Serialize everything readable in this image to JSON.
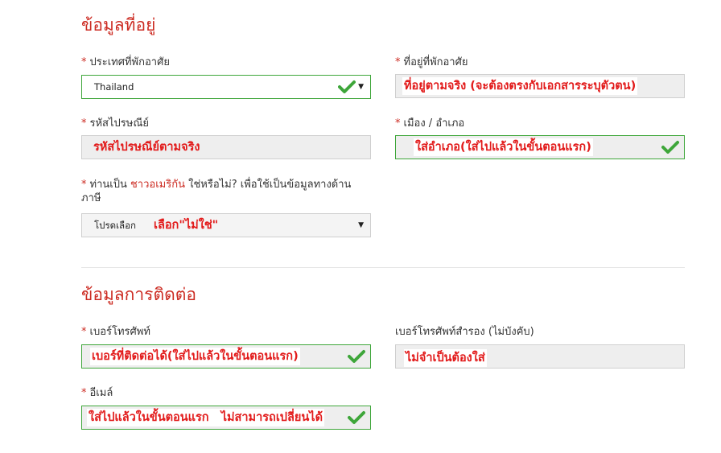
{
  "address_section": {
    "title": "ข้อมูลที่อยู่",
    "required_marker": "*",
    "country": {
      "label": "ประเทศที่พักอาศัย",
      "selected": "Thailand",
      "status": "valid"
    },
    "address": {
      "label": "ที่อยู่ที่พักอาศัย",
      "annotation": "ที่อยู่ตามจริง (จะต้องตรงกับเอกสารระบุตัวตน)"
    },
    "postal_code": {
      "label": "รหัสไปรษณีย์",
      "annotation": "รหัสไปรษณีย์ตามจริง"
    },
    "city": {
      "label": "เมือง / อำเภอ",
      "annotation": "ใส่อำเภอ(ใส่ไปแล้วในขั้นตอนแรก)",
      "status": "valid"
    },
    "us_citizen": {
      "label_prefix": "ท่านเป็น",
      "label_link": "ชาวอเมริกัน",
      "label_suffix": "ใช่หรือไม่? เพื่อใช้เป็นข้อมูลทางด้านภาษี",
      "selected": "โปรดเลือก",
      "annotation": "เลือก\"ไม่ใช่\""
    }
  },
  "contact_section": {
    "title": "ข้อมูลการติดต่อ",
    "phone": {
      "label": "เบอร์โทรศัพท์",
      "annotation": "เบอร์ที่ติดต่อได้(ใส่ไปแล้วในขั้นตอนแรก)",
      "status": "valid"
    },
    "alt_phone": {
      "label": "เบอร์โทรศัพท์สำรอง (ไม่บังคับ)",
      "annotation": "ไม่จำเป็นต้องใส่"
    },
    "email": {
      "label": "อีเมล์",
      "annotation": "ใส่ไปแล้วในขั้นตอนแรก   ไม่สามารถเปลี่ยนได้",
      "status": "valid"
    }
  },
  "colors": {
    "accent_red": "#cc2b22",
    "annotation_red": "#e21b1b",
    "valid_green": "#3ea63a"
  },
  "icons": {
    "valid": "checkmark-icon",
    "dropdown": "caret-down-icon"
  }
}
